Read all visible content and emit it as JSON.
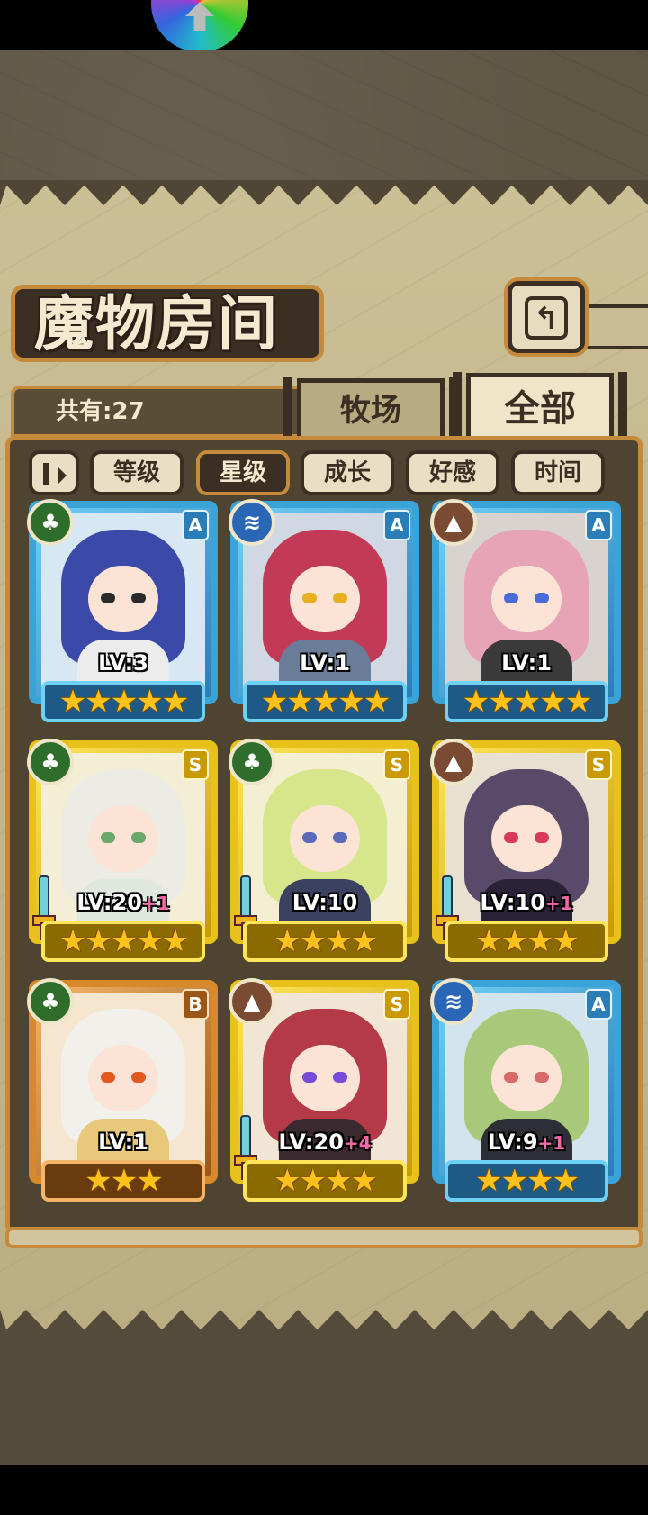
{
  "title": "魔物房间",
  "count_label": "共有:27",
  "tabs": [
    {
      "label": "牧场",
      "active": false
    },
    {
      "label": "全部",
      "active": true
    }
  ],
  "sort_buttons": [
    {
      "label": "等级",
      "active": false
    },
    {
      "label": "星级",
      "active": true
    },
    {
      "label": "成长",
      "active": false
    },
    {
      "label": "好感",
      "active": false
    },
    {
      "label": "时间",
      "active": false
    }
  ],
  "icons": {
    "back": "return-arrow-icon",
    "sort_toggle": "pause-play-icon",
    "element_grass": "leaf-icon",
    "element_water": "waves-icon",
    "element_earth": "mountain-icon",
    "weapon": "sword-icon"
  },
  "colors": {
    "rank_A": "#3aa3d8",
    "rank_S": "#e8c21a",
    "rank_B": "#d88a2b",
    "star": "#ffc21a",
    "level_bonus": "#f06aa8"
  },
  "monsters": [
    {
      "rank": "A",
      "element": "grass",
      "level": "LV:3",
      "bonus": "",
      "stars": "★★★★★",
      "weapon": false,
      "hair": "#3b4aa8",
      "eyes": "#2a2a2a",
      "bg": "#d7e7f3",
      "body": "#ececec"
    },
    {
      "rank": "A",
      "element": "water",
      "level": "LV:1",
      "bonus": "",
      "stars": "★★★★★",
      "weapon": false,
      "hair": "#c23a55",
      "eyes": "#e8b020",
      "bg": "#cfd8e3",
      "body": "#6a7c98"
    },
    {
      "rank": "A",
      "element": "earth",
      "level": "LV:1",
      "bonus": "",
      "stars": "★★★★★",
      "weapon": false,
      "hair": "#e7a4b6",
      "eyes": "#4a6ad8",
      "bg": "#d9d3cf",
      "body": "#3a3a3a"
    },
    {
      "rank": "S",
      "element": "grass",
      "level": "LV:20",
      "bonus": "+1",
      "stars": "★★★★★",
      "weapon": true,
      "hair": "#ecece4",
      "eyes": "#6aa86a",
      "bg": "#f3eed4",
      "body": "#dfe8dc"
    },
    {
      "rank": "S",
      "element": "grass",
      "level": "LV:10",
      "bonus": "",
      "stars": "★★★★",
      "weapon": true,
      "hair": "#d7e68a",
      "eyes": "#5a6ab8",
      "bg": "#f4efd2",
      "body": "#3b4260"
    },
    {
      "rank": "S",
      "element": "earth",
      "level": "LV:10",
      "bonus": "+1",
      "stars": "★★★★",
      "weapon": true,
      "hair": "#5a4a6a",
      "eyes": "#d83a5a",
      "bg": "#e8e0d0",
      "body": "#2a2338"
    },
    {
      "rank": "B",
      "element": "grass",
      "level": "LV:1",
      "bonus": "",
      "stars": "★★★",
      "weapon": false,
      "hair": "#f2f0ea",
      "eyes": "#e05a20",
      "bg": "#f6e6cf",
      "body": "#e8c87a"
    },
    {
      "rank": "S",
      "element": "earth",
      "level": "LV:20",
      "bonus": "+4",
      "stars": "★★★★",
      "weapon": true,
      "hair": "#b53a48",
      "eyes": "#7a4ad8",
      "bg": "#f1e6d6",
      "body": "#3a2a30"
    },
    {
      "rank": "A",
      "element": "water",
      "level": "LV:9",
      "bonus": "+1",
      "stars": "★★★★",
      "weapon": false,
      "hair": "#a9c97a",
      "eyes": "#d86a6a",
      "bg": "#d4e4ee",
      "body": "#2e2e36"
    }
  ]
}
